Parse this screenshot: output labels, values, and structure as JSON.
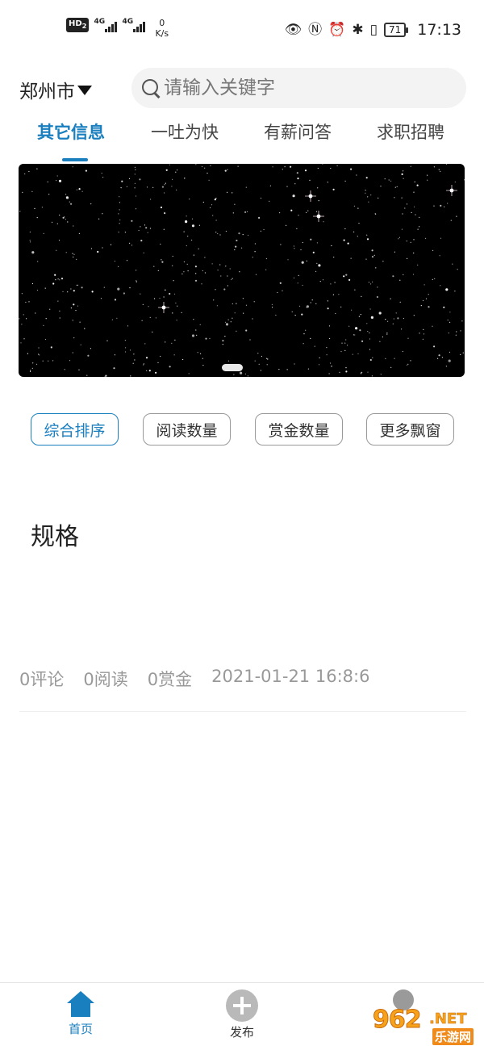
{
  "status_bar": {
    "hd": "HD",
    "hd_sub": "2",
    "net1": "4G",
    "net2": "4G",
    "speed_value": "0",
    "speed_unit": "K/s",
    "battery": "71",
    "time": "17:13"
  },
  "header": {
    "city": "郑州市",
    "search_placeholder": "请输入关键字"
  },
  "tabs": [
    "其它信息",
    "一吐为快",
    "有薪问答",
    "求职招聘"
  ],
  "active_tab": 0,
  "sort_options": [
    "综合排序",
    "阅读数量",
    "赏金数量",
    "更多飘窗"
  ],
  "active_sort": 0,
  "post": {
    "title": "规格",
    "comments": "0评论",
    "reads": "0阅读",
    "reward": "0赏金",
    "datetime": "2021-01-21 16:8:6"
  },
  "bottom_nav": {
    "items": [
      {
        "label": "首页",
        "icon": "home-icon"
      },
      {
        "label": "发布",
        "icon": "plus-circle-icon"
      },
      {
        "label": "",
        "icon": "user-icon"
      }
    ],
    "active": 0
  },
  "watermark": {
    "logo": "962",
    "suffix": ".NET",
    "site": "乐游网"
  },
  "colors": {
    "accent": "#1a7fbf",
    "muted": "#999999",
    "banner_bg": "#000000"
  }
}
